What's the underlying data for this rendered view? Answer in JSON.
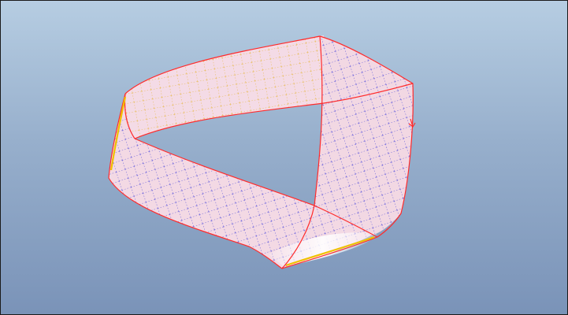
{
  "viewport": {
    "background_top": "#b6cde2",
    "background_bottom": "#7a93b8"
  },
  "model": {
    "object": "mobius-strip-surface",
    "surface_color": "#f2d9e4",
    "edge_color": "#ff2b2b",
    "mesh_color_u": "#f0c000",
    "mesh_color_v": "#2b2bd9",
    "display_mode": "shaded-with-mesh"
  }
}
